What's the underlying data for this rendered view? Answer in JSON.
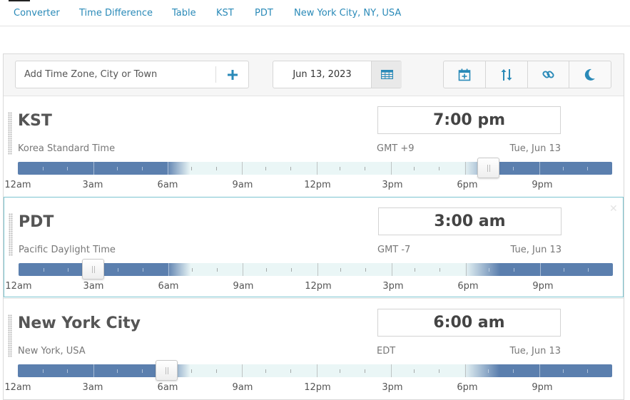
{
  "nav": {
    "tabs": [
      "Converter",
      "Time Difference",
      "Table",
      "KST",
      "PDT",
      "New York City, NY, USA"
    ]
  },
  "toolbar": {
    "search_placeholder": "Add Time Zone, City or Town",
    "add_icon": "plus-icon",
    "date": "Jun 13, 2023",
    "calendar_icon": "calendar-grid-icon",
    "actions": [
      "calendar-add-icon",
      "sort-arrows-icon",
      "link-icon",
      "moon-icon"
    ],
    "accent_color": "#2a8ab8"
  },
  "hour_labels": [
    "12am",
    "3am",
    "6am",
    "9am",
    "12pm",
    "3pm",
    "6pm",
    "9pm"
  ],
  "zones": [
    {
      "name": "KST",
      "subtitle": "Korea Standard Time",
      "time": "7:00 pm",
      "offset": "GMT +9",
      "date": "Tue, Jun 13",
      "slider_hour": 19,
      "selected": false
    },
    {
      "name": "PDT",
      "subtitle": "Pacific Daylight Time",
      "time": "3:00 am",
      "offset": "GMT -7",
      "date": "Tue, Jun 13",
      "slider_hour": 3,
      "selected": true
    },
    {
      "name": "New York City",
      "subtitle": "New York, USA",
      "time": "6:00 am",
      "offset": "EDT",
      "date": "Tue, Jun 13",
      "slider_hour": 6,
      "selected": false
    }
  ]
}
